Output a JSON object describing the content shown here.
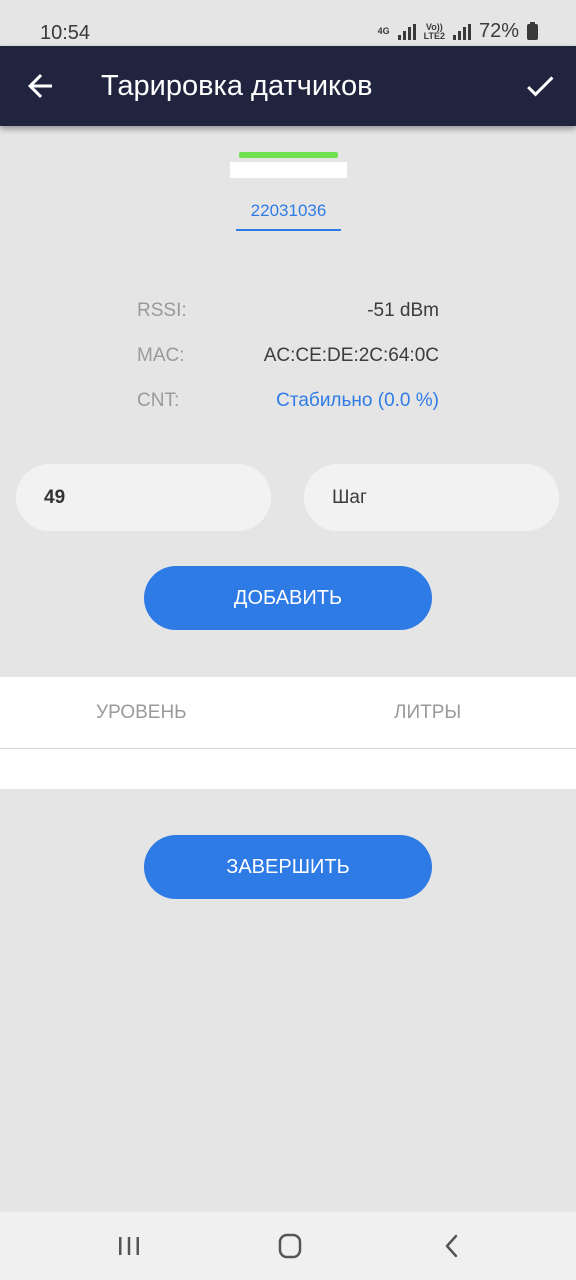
{
  "status_bar": {
    "time": "10:54",
    "network_top": "4G",
    "network_bottom": "",
    "volte_top": "Vo))",
    "volte_bottom": "LTE2",
    "battery": "72%"
  },
  "app_bar": {
    "title": "Тарировка датчиков",
    "back_icon": "arrow-left-icon",
    "confirm_icon": "check-icon"
  },
  "device": {
    "id": "22031036",
    "signal_color": "#6fe050"
  },
  "info": {
    "rssi_label": "RSSI:",
    "rssi_value": "-51 dBm",
    "mac_label": "MAC:",
    "mac_value": "AC:CE:DE:2C:64:0C",
    "cnt_label": "CNT:",
    "cnt_value": "Стабильно (0.0 %)"
  },
  "form": {
    "value_input": "49",
    "step_placeholder": "Шаг",
    "add_button": "ДОБАВИТЬ"
  },
  "table": {
    "columns": [
      "УРОВЕНЬ",
      "ЛИТРЫ"
    ],
    "rows": []
  },
  "finish_button": "ЗАВЕРШИТЬ",
  "nav_bar": {
    "recents_icon": "recents-icon",
    "home_icon": "home-icon",
    "back_icon": "nav-back-icon"
  },
  "colors": {
    "app_bar": "#20243f",
    "accent": "#2f7be6",
    "background": "#e5e5e5"
  }
}
